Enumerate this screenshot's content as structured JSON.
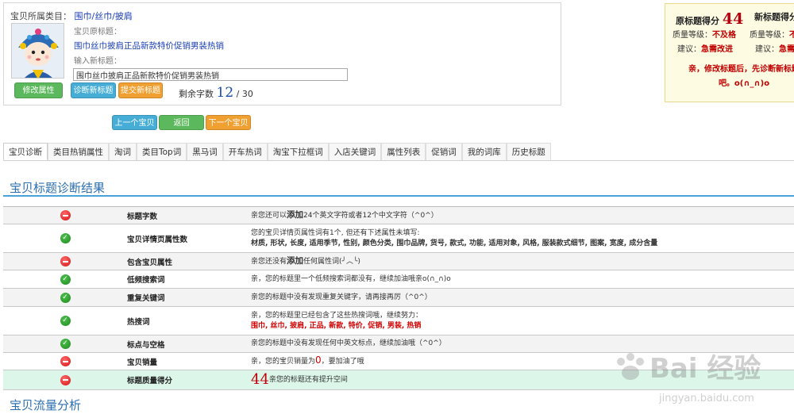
{
  "product": {
    "category_label": "宝贝所属类目：",
    "category_value": "围巾/丝巾/披肩",
    "orig_title_label": "宝贝原标题：",
    "orig_title": "围巾丝巾披肩正品新款特价促销男装热销",
    "new_title_label": "输入新标题：",
    "new_title_value": "围巾丝巾披肩正品新款特价促销男装热销",
    "buttons": {
      "modify": "修改属性",
      "diagnose": "诊断新标题",
      "submit": "提交新标题"
    },
    "remain_label": "剩余字数",
    "remain_count": "12",
    "remain_total": "/ 30"
  },
  "score_panel": {
    "orig_label": "原标题得分",
    "orig_score": "44",
    "new_label": "新标题得分",
    "quality_label_1": "质量等级：",
    "quality_value_1": "不及格",
    "quality_label_2": "质量等级：",
    "quality_value_2": "不",
    "advice_label_1": "建议：",
    "advice_value_1": "急需改进",
    "advice_label_2": "建议：",
    "advice_value_2": "急需",
    "message": "亲，修改标题后，先诊断新标题吧。o(∩_∩)o"
  },
  "nav": {
    "prev": "上一个宝贝",
    "back": "返回",
    "next": "下一个宝贝"
  },
  "tabs": [
    "宝贝诊断",
    "类目热销属性",
    "淘词",
    "类目Top词",
    "黑马词",
    "开车热词",
    "淘宝下拉框词",
    "入店关键词",
    "属性列表",
    "促销词",
    "我的词库",
    "历史标题"
  ],
  "section1_title": "宝贝标题诊断结果",
  "section2_title": "宝贝流量分析",
  "diagnosis": [
    {
      "status": "bad",
      "name": "标题字数",
      "detail_a": "亲您还可以",
      "detail_strong": "添加",
      "detail_b": "24个英文字符或者12个中文字符（^0^）"
    },
    {
      "status": "good",
      "name": "宝贝详情页属性数",
      "line1": "您的宝贝详情页属性词有1个, 但还有下述属性未填写:",
      "line2": "材质, 形状, 长度, 适用季节, 性别, 颜色分类, 围巾品牌, 货号, 款式, 功能, 适用对象, 风格, 服装款式细节, 图案, 宽度, 成分含量"
    },
    {
      "status": "bad",
      "name": "包含宝贝属性",
      "detail_a": "亲您还没有",
      "detail_strong": "添加",
      "detail_b": "任何属性词(╯︿╰)"
    },
    {
      "status": "good",
      "name": "低频搜索词",
      "detail": "亲，您的标题里一个低频搜索词都没有，继续加油哦亲o(∩_∩)o"
    },
    {
      "status": "good",
      "name": "重复关键词",
      "detail": "亲您的标题中没有发现重复关键字，请再接再厉（^0^）"
    },
    {
      "status": "good",
      "name": "热搜词",
      "line1": "亲，您的标题里已经包含了这些热搜词哦，继续努力：",
      "line2": "围巾, 丝巾, 披肩, 正品, 新款, 特价, 促销, 男装, 热销"
    },
    {
      "status": "good",
      "name": "标点与空格",
      "detail": "亲您的标题中没有发现任何中英文标点，继续加油哦（^0^）"
    },
    {
      "status": "bad",
      "name": "宝贝销量",
      "detail_a": "亲，您的宝贝销量为",
      "detail_red": "0",
      "detail_b": "，要加油了哦"
    },
    {
      "status": "bad",
      "name": "标题质量得分",
      "score": "44",
      "detail": "亲您的标题还有提升空间"
    }
  ],
  "watermark_text": "Bai 经验",
  "watermark_url": "jingyan.baidu.com"
}
